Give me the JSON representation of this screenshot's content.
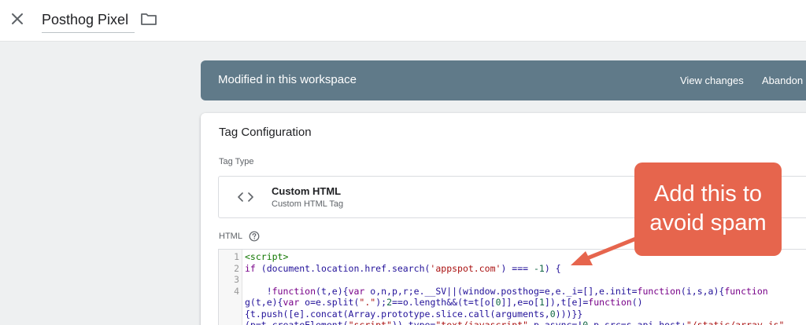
{
  "header": {
    "title": "Posthog Pixel",
    "close_icon": "close-icon",
    "folder_icon": "folder-icon"
  },
  "banner": {
    "text": "Modified in this workspace",
    "view_changes": "View changes",
    "abandon": "Abandon",
    "color": "#607a89"
  },
  "config": {
    "title": "Tag Configuration",
    "tag_type_label": "Tag Type",
    "tag_type": {
      "name": "Custom HTML",
      "description": "Custom HTML Tag",
      "icon": "code-icon"
    },
    "html_label": "HTML",
    "help_icon": "help-icon"
  },
  "code": {
    "line_numbers": [
      "1",
      "2",
      "3",
      "4",
      "",
      "",
      ""
    ],
    "lines": [
      [
        {
          "t": "<script>",
          "c": "tag"
        }
      ],
      [
        {
          "t": "if",
          "c": "kw"
        },
        {
          "t": " (document.location.href.search(",
          "c": ""
        },
        {
          "t": "'appspot.com'",
          "c": "str"
        },
        {
          "t": ") === ",
          "c": ""
        },
        {
          "t": "-1",
          "c": "num"
        },
        {
          "t": ") {",
          "c": ""
        }
      ],
      [],
      [
        {
          "t": "    !",
          "c": ""
        },
        {
          "t": "function",
          "c": "kw"
        },
        {
          "t": "(t,e){",
          "c": ""
        },
        {
          "t": "var",
          "c": "kw"
        },
        {
          "t": " o,n,p,r;e.__SV||(window.posthog=e,e._i=[],e.init=",
          "c": ""
        },
        {
          "t": "function",
          "c": "kw"
        },
        {
          "t": "(i,s,a){",
          "c": ""
        },
        {
          "t": "function",
          "c": "kw"
        }
      ],
      [
        {
          "t": "g(t,e){",
          "c": ""
        },
        {
          "t": "var",
          "c": "kw"
        },
        {
          "t": " o=e.split(",
          "c": ""
        },
        {
          "t": "\".\"",
          "c": "str"
        },
        {
          "t": ");",
          "c": ""
        },
        {
          "t": "2",
          "c": "num"
        },
        {
          "t": "==o.length&&(t=t[o[",
          "c": ""
        },
        {
          "t": "0",
          "c": "num"
        },
        {
          "t": "]],e=o[",
          "c": ""
        },
        {
          "t": "1",
          "c": "num"
        },
        {
          "t": "]),t[e]=",
          "c": ""
        },
        {
          "t": "function",
          "c": "kw"
        },
        {
          "t": "()",
          "c": ""
        }
      ],
      [
        {
          "t": "{t.push([e].concat(Array.prototype.slice.call(arguments,",
          "c": ""
        },
        {
          "t": "0",
          "c": "num"
        },
        {
          "t": ")))}}",
          "c": ""
        }
      ],
      [
        {
          "t": "(p=t.createElement(",
          "c": ""
        },
        {
          "t": "\"script\"",
          "c": "str"
        },
        {
          "t": ")).type=",
          "c": ""
        },
        {
          "t": "\"text/javascript\"",
          "c": "str"
        },
        {
          "t": ",p.async=!",
          "c": ""
        },
        {
          "t": "0",
          "c": "num"
        },
        {
          "t": ",p.src=s.api_host+",
          "c": ""
        },
        {
          "t": "\"/static/array.js\"",
          "c": "str"
        }
      ]
    ]
  },
  "annotation": {
    "text": "Add this to\navoid spam",
    "color": "#e6654d"
  }
}
